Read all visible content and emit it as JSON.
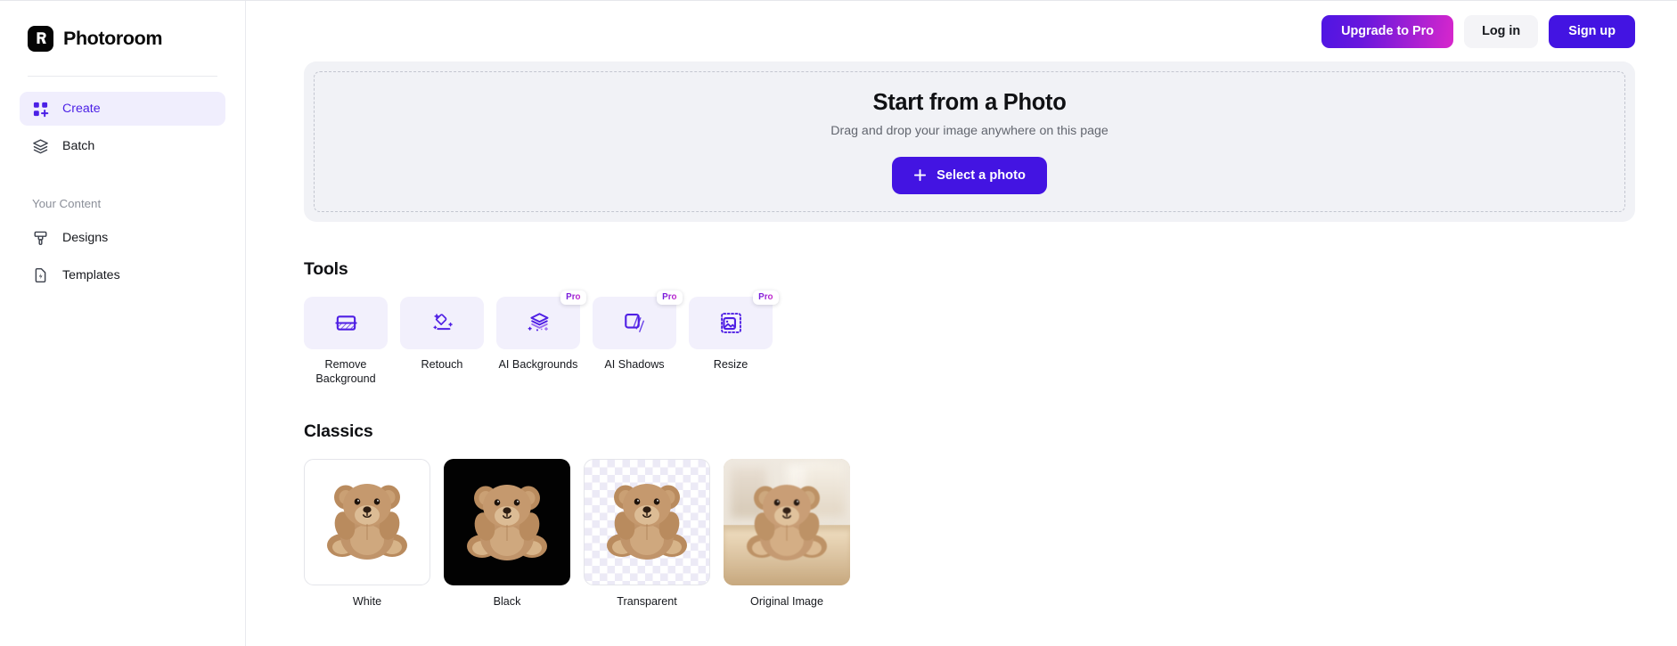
{
  "brand": {
    "name": "Photoroom",
    "logo_icon": "photoroom-logo-icon"
  },
  "sidebar": {
    "nav": [
      {
        "label": "Create",
        "icon": "grid-plus-icon",
        "active": true
      },
      {
        "label": "Batch",
        "icon": "layers-icon",
        "active": false
      }
    ],
    "section_title": "Your Content",
    "content_items": [
      {
        "label": "Designs",
        "icon": "paint-brush-icon"
      },
      {
        "label": "Templates",
        "icon": "document-bolt-icon"
      }
    ]
  },
  "header": {
    "upgrade_label": "Upgrade to Pro",
    "login_label": "Log in",
    "signup_label": "Sign up"
  },
  "dropzone": {
    "title": "Start from a Photo",
    "subtitle": "Drag and drop your image anywhere on this page",
    "button_label": "Select a photo",
    "button_icon": "plus-icon"
  },
  "tools": {
    "title": "Tools",
    "items": [
      {
        "label": "Remove Background",
        "icon": "remove-background-icon",
        "pro": false,
        "badge": ""
      },
      {
        "label": "Retouch",
        "icon": "eraser-sparkle-icon",
        "pro": false,
        "badge": ""
      },
      {
        "label": "AI Backgrounds",
        "icon": "ai-layers-sparkle-icon",
        "pro": true,
        "badge": "Pro"
      },
      {
        "label": "AI Shadows",
        "icon": "square-shadow-icon",
        "pro": true,
        "badge": "Pro"
      },
      {
        "label": "Resize",
        "icon": "resize-image-icon",
        "pro": true,
        "badge": "Pro"
      }
    ]
  },
  "classics": {
    "title": "Classics",
    "items": [
      {
        "label": "White",
        "background": "white"
      },
      {
        "label": "Black",
        "background": "black"
      },
      {
        "label": "Transparent",
        "background": "transparent"
      },
      {
        "label": "Original Image",
        "background": "original"
      }
    ]
  },
  "colors": {
    "accent": "#4314e2",
    "accent_soft": "#f0eefd",
    "upgrade_gradient_start": "#4e16e3",
    "upgrade_gradient_end": "#d827cc",
    "tool_tile": "#f2f0fc",
    "dropzone_bg": "#f1f2f6",
    "text": "#16181d",
    "muted_text": "#8b8f99"
  }
}
